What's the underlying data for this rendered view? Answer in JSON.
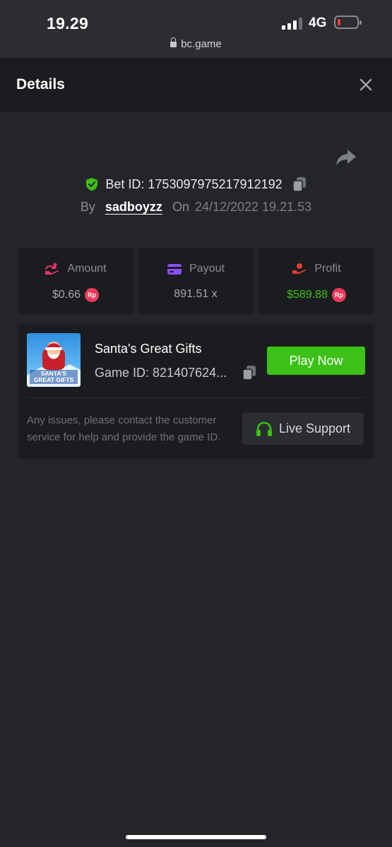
{
  "status_bar": {
    "time": "19.29",
    "network": "4G",
    "url": "bc.game"
  },
  "header": {
    "title": "Details"
  },
  "bet": {
    "label": "Bet ID:",
    "id": "1753097975217912192",
    "by_label": "By",
    "user": "sadboyzz",
    "on_label": "On",
    "date": "24/12/2022 19.21.53"
  },
  "stats": {
    "amount": {
      "label": "Amount",
      "value": "$0.66",
      "currency_badge": "Rp"
    },
    "payout": {
      "label": "Payout",
      "value": "891.51 x"
    },
    "profit": {
      "label": "Profit",
      "value": "$589.88",
      "currency_badge": "Rp"
    }
  },
  "game": {
    "name": "Santa's Great Gifts",
    "thumbnail_text_1": "SANTA'S",
    "thumbnail_text_2": "GREAT GIFTS",
    "id_label": "Game ID:",
    "id_text": "Game ID: 821407624...",
    "play_label": "Play Now",
    "issue_text": "Any issues, please contact the customer service for help and provide the game ID.",
    "support_label": "Live Support"
  },
  "colors": {
    "background": "#232528",
    "panel": "#1b1c1f",
    "accent_green": "#3bc117",
    "badge_red": "#ea3a5a",
    "payout_purple": "#8e4dff",
    "amount_pink": "#e8336b"
  }
}
